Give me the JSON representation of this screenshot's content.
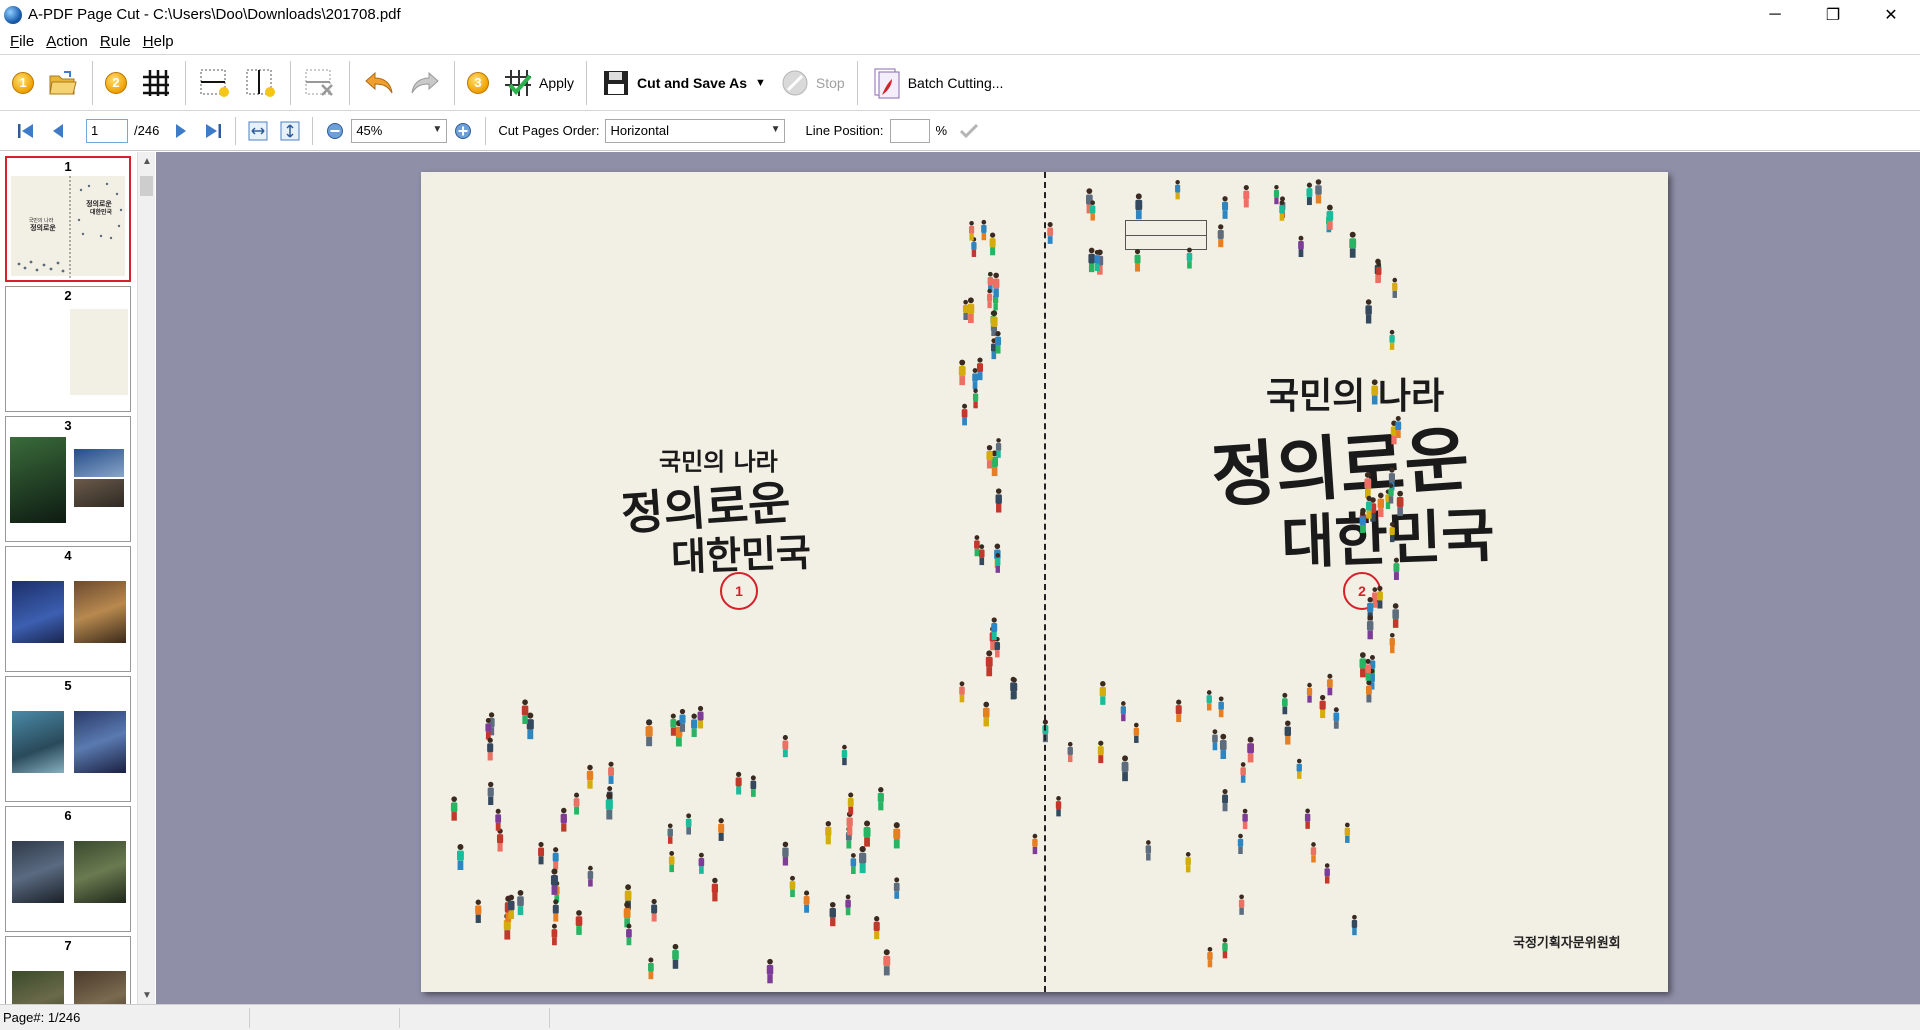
{
  "window": {
    "title": "A-PDF Page Cut - C:\\Users\\Doo\\Downloads\\201708.pdf",
    "minimize": "─",
    "maximize": "❐",
    "close": "✕"
  },
  "menu": [
    "File",
    "Action",
    "Rule",
    "Help"
  ],
  "toolbar": {
    "step1": "1",
    "step2": "2",
    "step3": "3",
    "apply_label": "Apply",
    "cut_save_label": "Cut and Save As",
    "stop_label": "Stop",
    "batch_label": "Batch Cutting..."
  },
  "navbar": {
    "current_page": "1",
    "total_pages": "/246",
    "zoom": "45%",
    "cut_order_label": "Cut Pages Order:",
    "cut_order_value": "Horizontal",
    "line_position_label": "Line Position:",
    "line_position_value": "",
    "percent": "%"
  },
  "thumbnails": [
    {
      "num": "1",
      "selected": true
    },
    {
      "num": "2",
      "selected": false
    },
    {
      "num": "3",
      "selected": false
    },
    {
      "num": "4",
      "selected": false
    },
    {
      "num": "5",
      "selected": false
    },
    {
      "num": "6",
      "selected": false
    },
    {
      "num": "7",
      "selected": false
    }
  ],
  "document": {
    "left_title_line1": "국민의 나라",
    "left_title_line2": "정의로운",
    "left_title_line3": "대한민국",
    "right_title_line1": "국민의 나라",
    "right_title_line2": "정의로운",
    "right_title_line3": "대한민국",
    "publisher": "국정기획자문위원회",
    "marker_left": "1",
    "marker_right": "2"
  },
  "status": {
    "page": "Page#: 1/246"
  },
  "colors": {
    "canvas_bg": "#8f8fa8",
    "page_bg": "#f2efe4",
    "marker": "#d6202a",
    "accent_step": "#f0a000"
  }
}
